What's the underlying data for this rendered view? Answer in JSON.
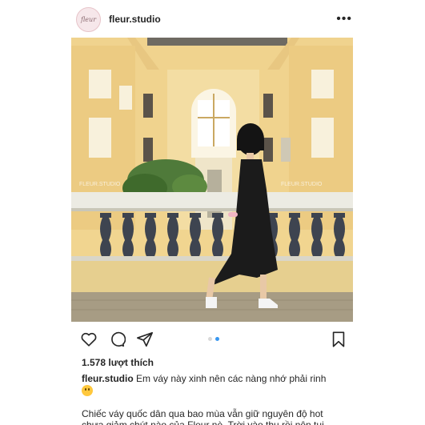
{
  "post": {
    "username": "fleur.studio",
    "avatar_text": "fleur",
    "more_label": "•••",
    "likes": "1.578 lượt thích",
    "caption_user": "fleur.studio",
    "caption_text": "Em váy này xinh nên các nàng nhớ phải rinh",
    "caption_line2": "Chiếc váy quốc dân qua bao mùa vẫn giữ nguyên độ hot chưa giảm chút nào của Fleur nè. Trời vào thu rồi nên tụi"
  },
  "photo": {
    "watermark": "FLEUR.STUDIO"
  },
  "carousel": {
    "count": 2,
    "active": 2
  },
  "icons": [
    "heart-icon",
    "comment-icon",
    "share-icon",
    "bookmark-icon",
    "more-icon",
    "smiley-emoji-icon"
  ],
  "colors": {
    "wall": "#f1d590",
    "dress": "#1b1b1b",
    "accent": "#3897f0"
  }
}
